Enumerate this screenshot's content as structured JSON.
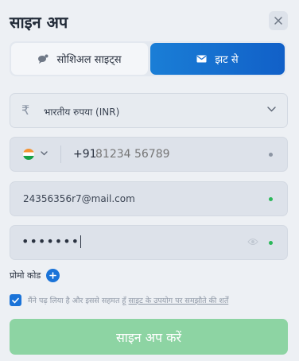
{
  "header": {
    "title": "साइन अप"
  },
  "tabs": [
    {
      "label": "सोशिअल साइट्स",
      "icon": "chat-bubble-icon",
      "active": false
    },
    {
      "label": "झट से",
      "icon": "envelope-icon",
      "active": true
    }
  ],
  "currency": {
    "symbol": "₹",
    "value": "भारतीय रुपया (INR)"
  },
  "phone": {
    "country_code": "+91",
    "placeholder": "81234 56789",
    "flag": "india-flag"
  },
  "email": {
    "value": "24356356r7@mail.com"
  },
  "password": {
    "value": "•••••••"
  },
  "promo": {
    "label": "प्रोमो कोड"
  },
  "terms": {
    "prefix": "मैंने पढ़ लिया है और इससे सहमत हूँ ",
    "link": "साइट के उपयोग पर समझौते की शर्तें",
    "checked": true
  },
  "submit": {
    "label": "साइन अप करें"
  },
  "colors": {
    "accent": "#1a73d8",
    "submit_bg": "#8dd4a3",
    "valid": "#2bb85a"
  }
}
